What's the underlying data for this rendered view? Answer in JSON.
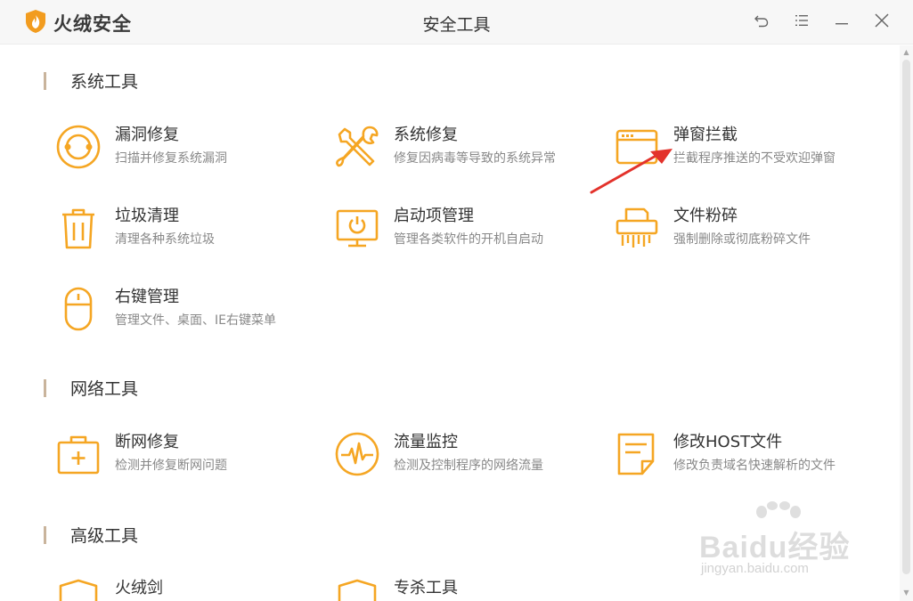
{
  "app": {
    "name": "火绒安全",
    "window_title": "安全工具"
  },
  "window_controls": [
    {
      "name": "back-icon",
      "glyph": "back"
    },
    {
      "name": "menu-icon",
      "glyph": "menu"
    },
    {
      "name": "minimize-icon",
      "glyph": "minimize"
    },
    {
      "name": "close-icon",
      "glyph": "close"
    }
  ],
  "accent_color": "#f5a623",
  "sections": {
    "system": {
      "title": "系统工具",
      "tools": [
        {
          "name": "漏洞修复",
          "desc": "扫描并修复系统漏洞",
          "icon": "vulnerability-fix-icon"
        },
        {
          "name": "系统修复",
          "desc": "修复因病毒等导致的系统异常",
          "icon": "wrench-screwdriver-icon"
        },
        {
          "name": "弹窗拦截",
          "desc": "拦截程序推送的不受欢迎弹窗",
          "icon": "popup-window-icon"
        },
        {
          "name": "垃圾清理",
          "desc": "清理各种系统垃圾",
          "icon": "trash-can-icon"
        },
        {
          "name": "启动项管理",
          "desc": "管理各类软件的开机自启动",
          "icon": "monitor-power-icon"
        },
        {
          "name": "文件粉碎",
          "desc": "强制删除或彻底粉碎文件",
          "icon": "shredder-icon"
        },
        {
          "name": "右键管理",
          "desc": "管理文件、桌面、IE右键菜单",
          "icon": "mouse-icon"
        }
      ]
    },
    "network": {
      "title": "网络工具",
      "tools": [
        {
          "name": "断网修复",
          "desc": "检测并修复断网问题",
          "icon": "first-aid-kit-icon"
        },
        {
          "name": "流量监控",
          "desc": "检测及控制程序的网络流量",
          "icon": "pulse-icon"
        },
        {
          "name": "修改HOST文件",
          "desc": "修改负责域名快速解析的文件",
          "icon": "edit-document-icon"
        }
      ]
    },
    "advanced": {
      "title": "高级工具",
      "tools": [
        {
          "name": "火绒剑",
          "desc": "",
          "icon": "shield-icon"
        },
        {
          "name": "专杀工具",
          "desc": "",
          "icon": "shield-icon"
        }
      ]
    }
  },
  "watermark": {
    "line1": "Baidu经验",
    "line2": "jingyan.baidu.com"
  }
}
